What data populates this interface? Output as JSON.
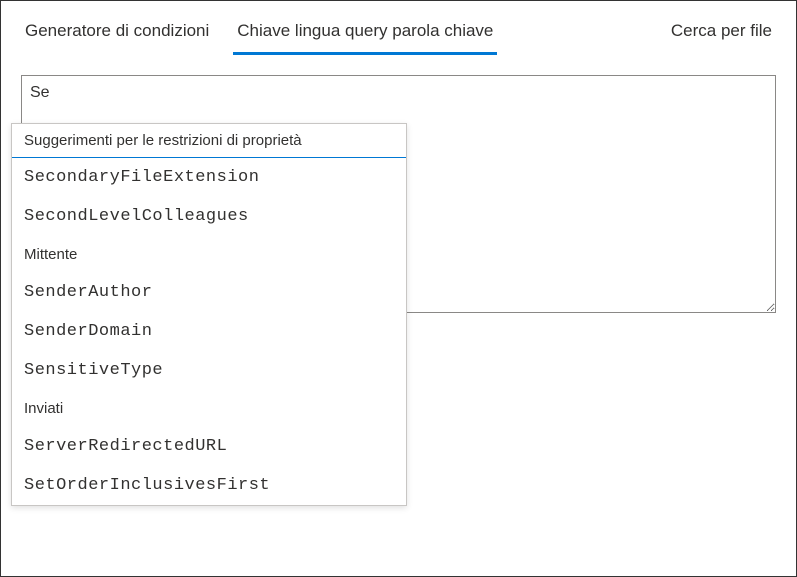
{
  "tabs": {
    "condition_builder": "Generatore di condizioni",
    "kql": "Chiave lingua query parola chiave",
    "search_by_file": "Cerca per file"
  },
  "query": {
    "value": "Se"
  },
  "suggestions": {
    "header": "Suggerimenti per le restrizioni di proprietà",
    "items": [
      {
        "label": "SecondaryFileExtension",
        "style": "mono"
      },
      {
        "label": "SecondLevelColleagues",
        "style": "mono"
      },
      {
        "label": "Mittente",
        "style": "plain"
      },
      {
        "label": "SenderAuthor",
        "style": "mono"
      },
      {
        "label": "SenderDomain",
        "style": "mono"
      },
      {
        "label": "SensitiveType",
        "style": "mono"
      },
      {
        "label": "Inviati",
        "style": "plain"
      },
      {
        "label": "ServerRedirectedURL",
        "style": "mono"
      },
      {
        "label": "SetOrderInclusivesFirst",
        "style": "mono"
      }
    ]
  }
}
